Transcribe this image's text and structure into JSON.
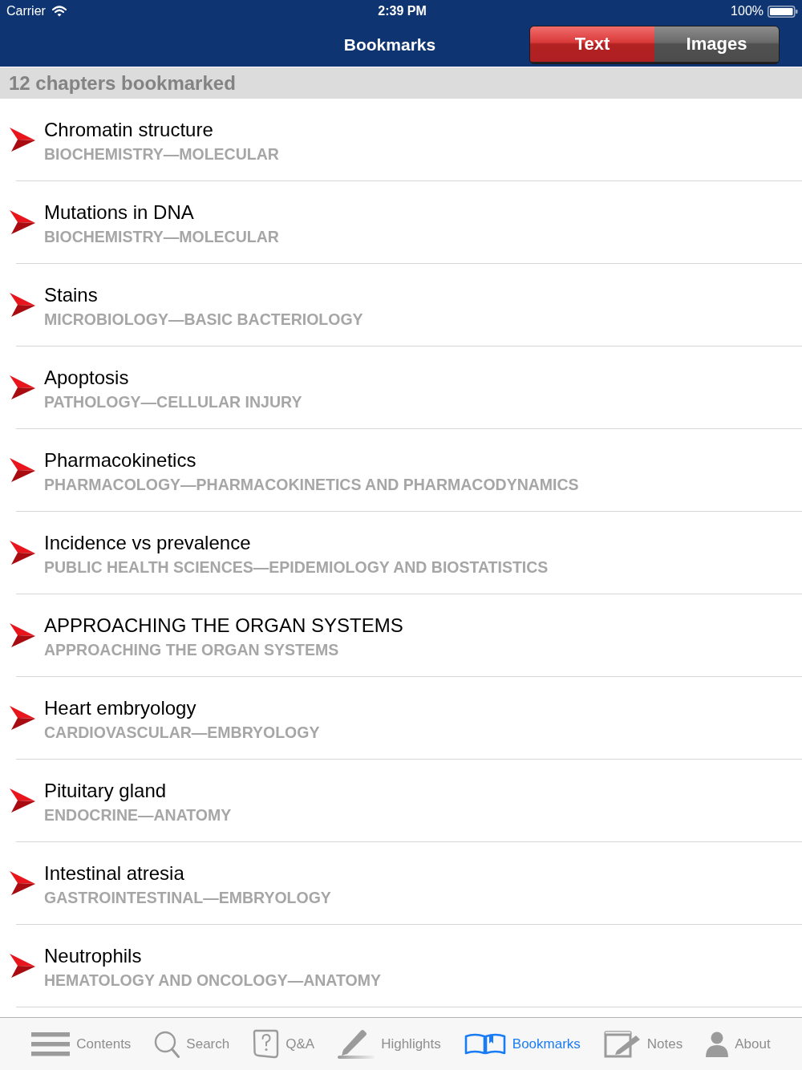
{
  "status_bar": {
    "carrier": "Carrier",
    "time": "2:39 PM",
    "battery": "100%"
  },
  "nav_bar": {
    "title": "Bookmarks",
    "segments": [
      {
        "label": "Text",
        "selected": true
      },
      {
        "label": "Images",
        "selected": false
      }
    ]
  },
  "section_header": "12 chapters bookmarked",
  "bookmarks": [
    {
      "title": "Chromatin structure",
      "subtitle": "BIOCHEMISTRY—MOLECULAR"
    },
    {
      "title": "Mutations in DNA",
      "subtitle": "BIOCHEMISTRY—MOLECULAR"
    },
    {
      "title": "Stains",
      "subtitle": "MICROBIOLOGY—BASIC BACTERIOLOGY"
    },
    {
      "title": "Apoptosis",
      "subtitle": "PATHOLOGY—CELLULAR INJURY"
    },
    {
      "title": "Pharmacokinetics",
      "subtitle": "PHARMACOLOGY—PHARMACOKINETICS AND PHARMACODYNAMICS"
    },
    {
      "title": "Incidence vs prevalence",
      "subtitle": "PUBLIC HEALTH SCIENCES—EPIDEMIOLOGY AND BIOSTATISTICS"
    },
    {
      "title": "APPROACHING THE ORGAN SYSTEMS",
      "subtitle": "APPROACHING THE ORGAN SYSTEMS"
    },
    {
      "title": "Heart embryology",
      "subtitle": "CARDIOVASCULAR—EMBRYOLOGY"
    },
    {
      "title": "Pituitary gland",
      "subtitle": "ENDOCRINE—ANATOMY"
    },
    {
      "title": "Intestinal atresia",
      "subtitle": "GASTROINTESTINAL—EMBRYOLOGY"
    },
    {
      "title": "Neutrophils",
      "subtitle": "HEMATOLOGY AND ONCOLOGY—ANATOMY"
    }
  ],
  "tab_bar": [
    {
      "label": "Contents",
      "kind": "contents",
      "selected": false
    },
    {
      "label": "Search",
      "kind": "search",
      "selected": false
    },
    {
      "label": "Q&A",
      "kind": "qa",
      "selected": false
    },
    {
      "label": "Highlights",
      "kind": "highlights",
      "selected": false
    },
    {
      "label": "Bookmarks",
      "kind": "bookmarks",
      "selected": true
    },
    {
      "label": "Notes",
      "kind": "notes",
      "selected": false
    },
    {
      "label": "About",
      "kind": "about",
      "selected": false
    }
  ]
}
